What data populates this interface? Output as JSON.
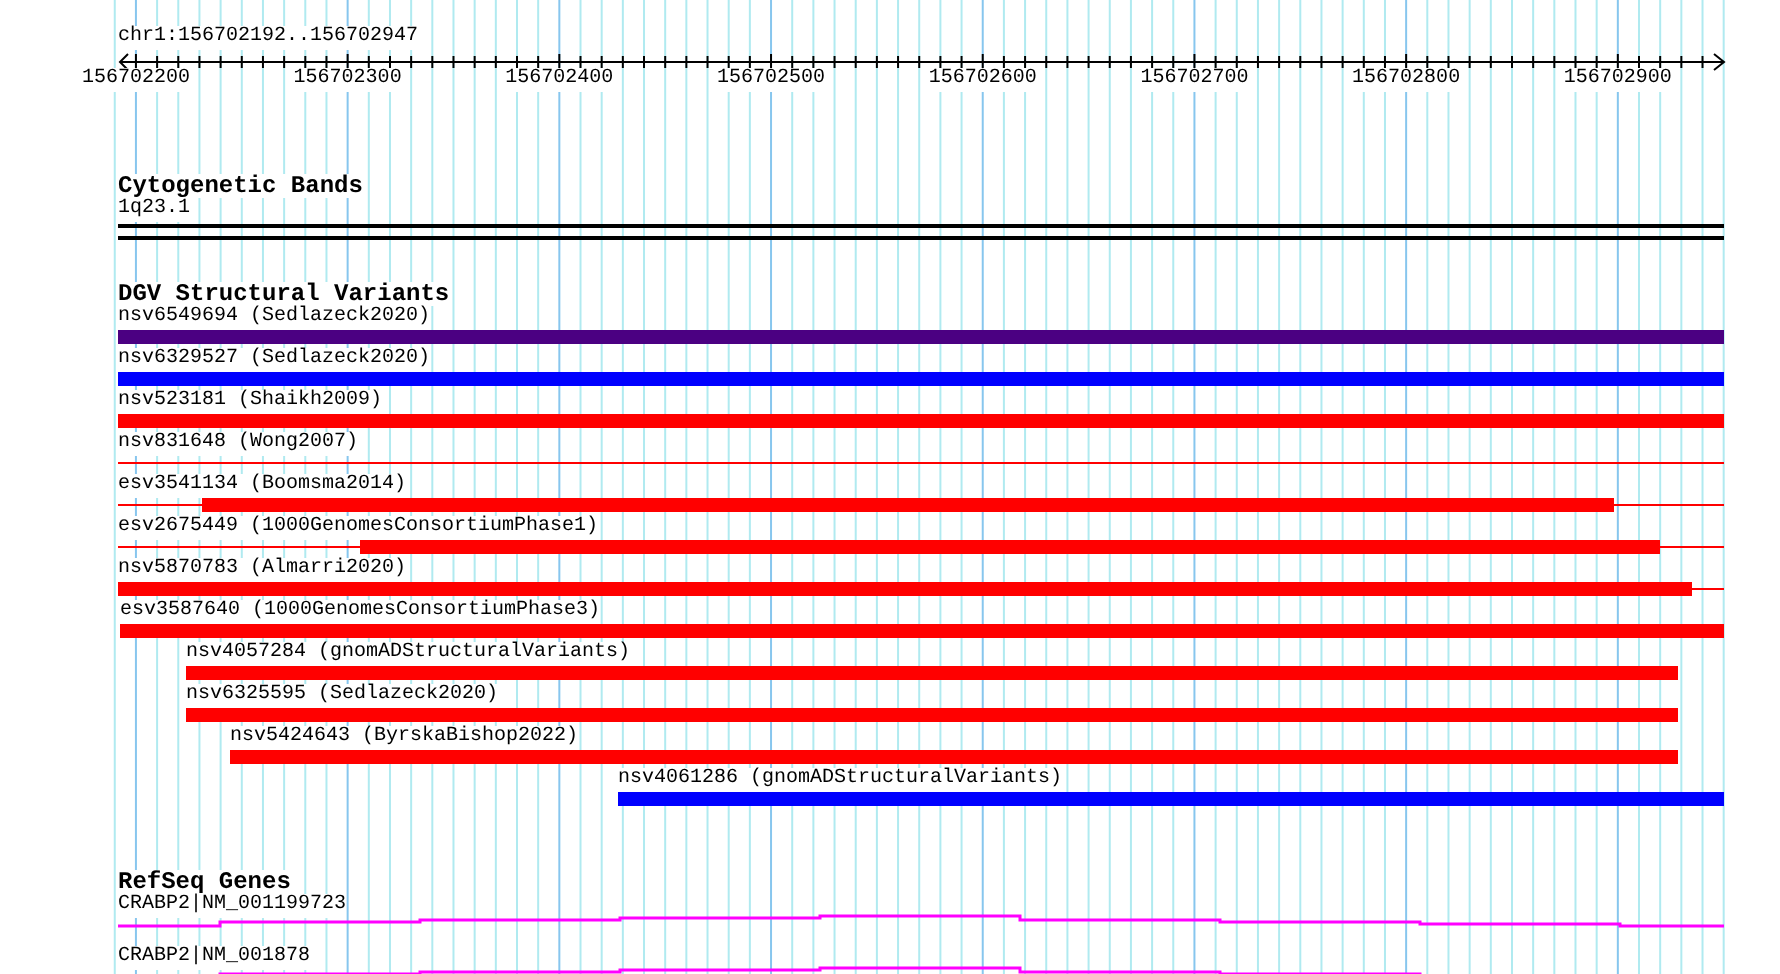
{
  "locus": "chr1:156702192..156702947",
  "ruler": {
    "ticks": [
      "156702200",
      "156702300",
      "156702400",
      "156702500",
      "156702600",
      "156702700",
      "156702800",
      "156702900"
    ]
  },
  "tracks": [
    {
      "kind": "bands",
      "title": "Cytogenetic Bands",
      "features": [
        {
          "label": "1q23.1"
        }
      ]
    },
    {
      "kind": "variants",
      "title": "DGV Structural Variants",
      "features": [
        {
          "label": "nsv6549694 (Sedlazeck2020)",
          "color": "#4b0082"
        },
        {
          "label": "nsv6329527 (Sedlazeck2020)",
          "color": "#0000ff"
        },
        {
          "label": "nsv523181 (Shaikh2009)",
          "color": "#ff0000"
        },
        {
          "label": "nsv831648 (Wong2007)",
          "color": "#ff0000"
        },
        {
          "label": "esv3541134 (Boomsma2014)",
          "color": "#ff0000"
        },
        {
          "label": "esv2675449 (1000GenomesConsortiumPhase1)",
          "color": "#ff0000"
        },
        {
          "label": "nsv5870783 (Almarri2020)",
          "color": "#ff0000"
        },
        {
          "label": "esv3587640 (1000GenomesConsortiumPhase3)",
          "color": "#ff0000"
        },
        {
          "label": "nsv4057284 (gnomADStructuralVariants)",
          "color": "#ff0000"
        },
        {
          "label": "nsv6325595 (Sedlazeck2020)",
          "color": "#ff0000"
        },
        {
          "label": "nsv5424643 (ByrskaBishop2022)",
          "color": "#ff0000"
        },
        {
          "label": "nsv4061286 (gnomADStructuralVariants)",
          "color": "#0000ff"
        }
      ]
    },
    {
      "kind": "genes",
      "title": "RefSeq Genes",
      "features": [
        {
          "label": "CRABP2|NM_001199723"
        },
        {
          "label": "CRABP2|NM_001878"
        }
      ]
    }
  ]
}
